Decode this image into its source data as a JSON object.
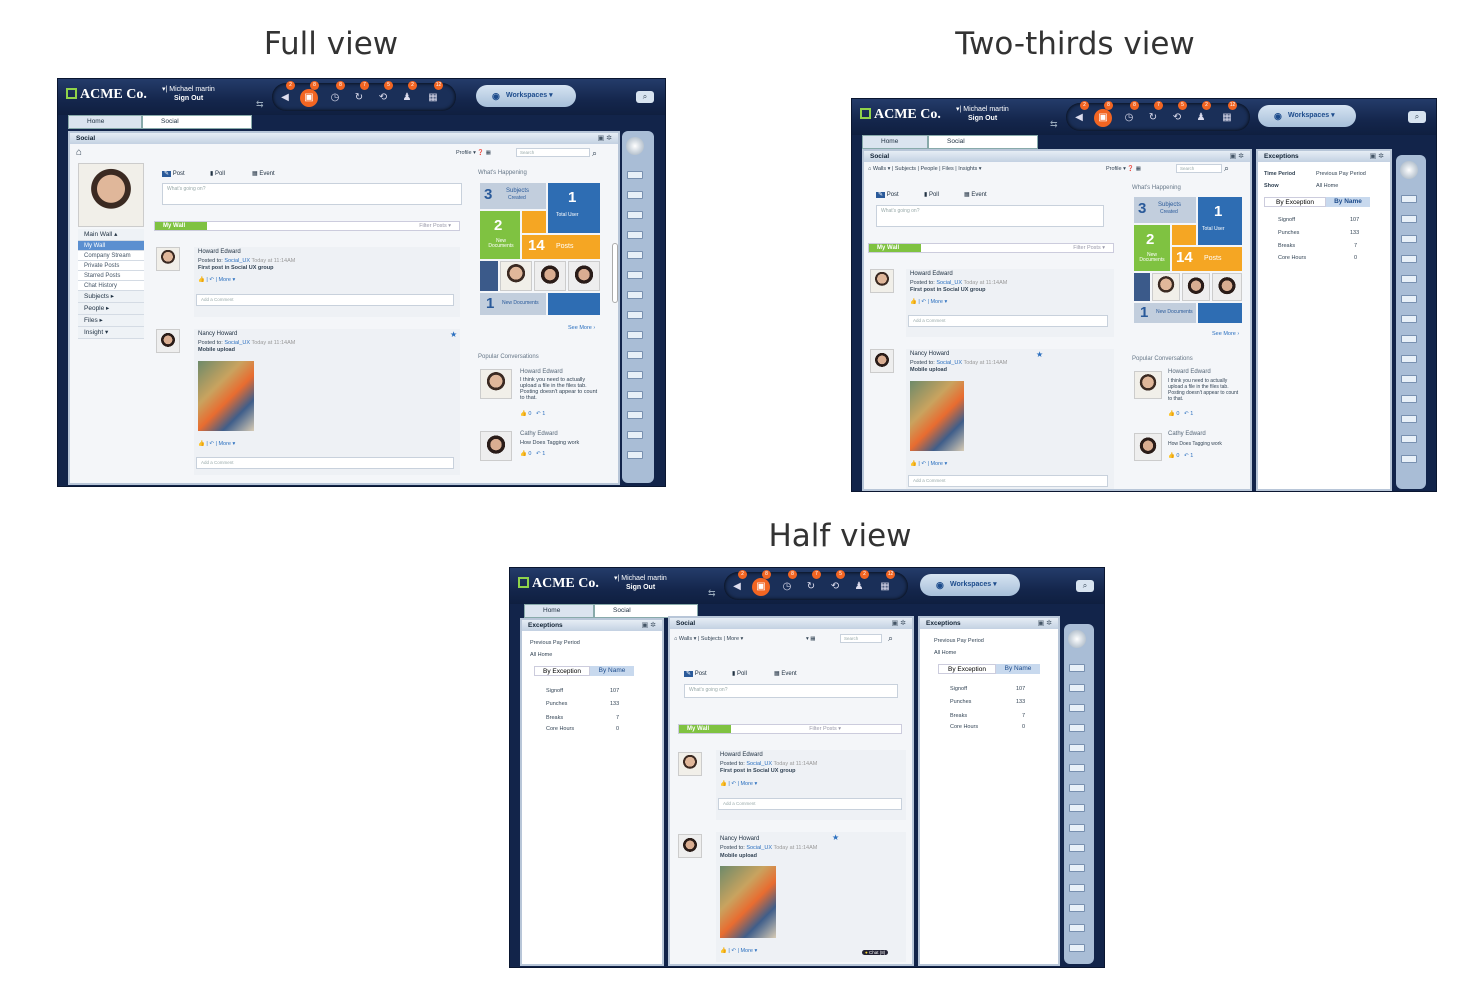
{
  "titles": {
    "full": "Full view",
    "two_thirds": "Two-thirds view",
    "half": "Half view"
  },
  "app": {
    "logo": "ACME Co.",
    "user_name": "Michael martin",
    "sign_out": "Sign Out",
    "workspaces": "Workspaces",
    "badges": [
      "2",
      "8",
      "8",
      "7",
      "5",
      "2",
      "12"
    ],
    "icons": [
      "megaphone-icon",
      "social-icon",
      "clock-icon",
      "refresh-icon",
      "history-icon",
      "people-icon",
      "calendar-icon"
    ],
    "tabs": {
      "home": "Home",
      "social": "Social"
    }
  },
  "social": {
    "title": "Social",
    "profile": "Profile",
    "search": "Search",
    "nav": [
      "Walls",
      "Subjects",
      "People",
      "Files",
      "Insights"
    ],
    "nav_half": [
      "Walls",
      "Subjects",
      "More"
    ],
    "compose": {
      "post": "Post",
      "poll": "Poll",
      "event": "Event",
      "placeholder": "What's going on?"
    },
    "my_wall": "My Wall",
    "filter": "Filter Posts",
    "sidebar": {
      "main_wall": "Main Wall",
      "items": [
        "My Wall",
        "Company Stream",
        "Private Posts",
        "Starred Posts",
        "Chat History"
      ],
      "groups": [
        "Subjects",
        "People",
        "Files",
        "Insight"
      ]
    },
    "posts": [
      {
        "author": "Howard Edward",
        "posted_to_label": "Posted to:",
        "posted_to": "Social_UX",
        "time": "Today at 11:14AM",
        "body": "First post in Social UX group",
        "more": "More",
        "comment": "Add a Comment"
      },
      {
        "author": "Nancy Howard",
        "posted_to_label": "Posted to:",
        "posted_to": "Social_UX",
        "time": "Today at 11:14AM",
        "body": "Mobile upload",
        "more": "More",
        "comment": "Add a Comment"
      }
    ],
    "happening": {
      "title": "What's Happening",
      "subjects_n": "3",
      "subjects": "Subjects",
      "subjects_sub": "Created",
      "users_n": "1",
      "users": "Total User",
      "docs_n": "2",
      "docs": "New Documents",
      "posts_n": "14",
      "posts": "Posts",
      "newdocs_n": "1",
      "newdocs": "New Documents",
      "see_more": "See More ›"
    },
    "popular": {
      "title": "Popular Conversations",
      "items": [
        {
          "author": "Howard Edward",
          "text": "I think you need to actually upload a file in the files tab. Posting doesn't appear to count to that.",
          "likes": "0",
          "replies": "1"
        },
        {
          "author": "Cathy Edward",
          "text": "How Does Tagging work",
          "likes": "0",
          "replies": "1"
        }
      ]
    },
    "chat": "Chat (8)"
  },
  "exceptions": {
    "title": "Exceptions",
    "time_period_label": "Time Period",
    "time_period": "Previous Pay Period",
    "show_label": "Show",
    "show": "All Home",
    "tab_exception": "By Exception",
    "tab_name": "By Name",
    "rows": [
      {
        "label": "Signoff",
        "value": "107"
      },
      {
        "label": "Punches",
        "value": "133"
      },
      {
        "label": "Breaks",
        "value": "7"
      },
      {
        "label": "Core Hours",
        "value": "0"
      }
    ]
  }
}
